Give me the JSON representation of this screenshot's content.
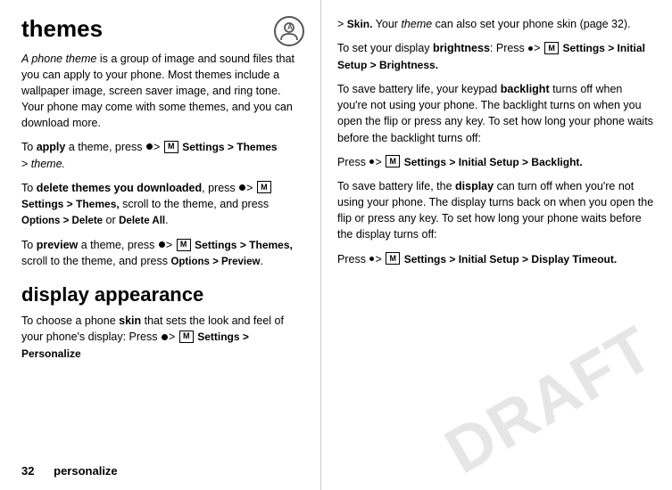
{
  "left": {
    "heading1": "themes",
    "intro": "A phone theme is a group of image and sound files that you can apply to your phone. Most themes include a wallpaper image, screen saver image, and ring tone. Your phone may come with some themes, and you can download more.",
    "apply_label": "apply",
    "apply_text": "a theme, press",
    "apply_path": "Settings > Themes > theme.",
    "delete_label": "delete themes you downloaded",
    "delete_text": ", press",
    "delete_path2": "Settings > Themes,",
    "delete_text2": "scroll to the theme, and press",
    "delete_options": "Options > Delete",
    "delete_or": "or",
    "delete_all": "Delete All",
    "preview_label": "preview",
    "preview_text1": "a theme, press",
    "preview_path": "Settings > Themes,",
    "preview_text2": "scroll to the theme, and press",
    "preview_options": "Options > Preview",
    "heading2": "display appearance",
    "skin_intro": "To choose a phone",
    "skin_label": "skin",
    "skin_text": "that sets the look and feel of your phone's display: Press",
    "skin_path": "Settings > Personalize",
    "page_number": "32",
    "page_label": "personalize"
  },
  "right": {
    "skin_suffix": "> Skin.",
    "skin_desc": "Your theme can also set your phone skin (page 32).",
    "brightness_intro": "To set your display",
    "brightness_label": "brightness",
    "brightness_text": ": Press",
    "brightness_path": "Settings > Initial Setup > Brightness.",
    "backlight_intro1": "To save battery life, your keypad",
    "backlight_label": "backlight",
    "backlight_text1": "turns off when you're not using your phone. The backlight turns on when you open the flip or press any key. To set how long your phone waits before the backlight turns off:",
    "backlight_press": "Press",
    "backlight_path": "Settings > Initial Setup > Backlight.",
    "display_intro1": "To save battery life, the",
    "display_label": "display",
    "display_text1": "can turn off when you're not using your phone. The display turns back on when you open the flip or press any key. To set how long your phone waits before the display turns off:",
    "display_press": "Press",
    "display_path": "Settings > Initial Setup > Display Timeout.",
    "draft_watermark": "DRAFT"
  },
  "icons": {
    "settings_char": "M",
    "bullet": "•",
    "gt": ">"
  }
}
